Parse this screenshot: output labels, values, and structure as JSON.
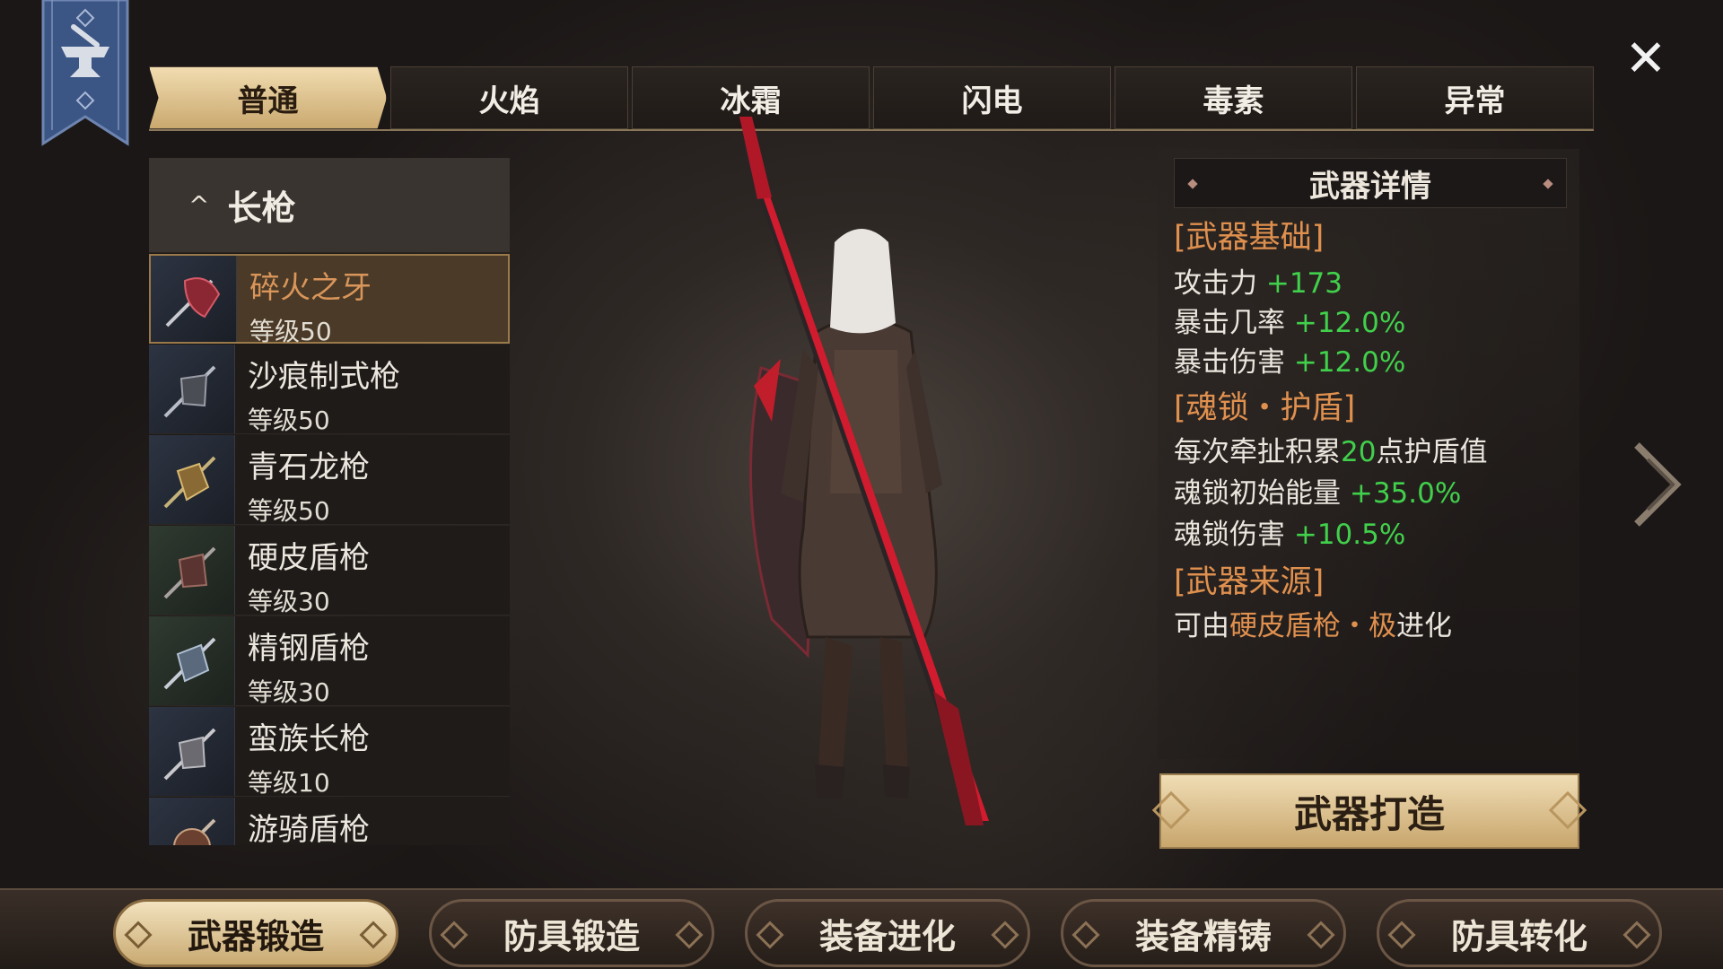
{
  "tabs": [
    {
      "label": "普通",
      "active": true
    },
    {
      "label": "火焰",
      "active": false
    },
    {
      "label": "冰霜",
      "active": false
    },
    {
      "label": "闪电",
      "active": false
    },
    {
      "label": "毒素",
      "active": false
    },
    {
      "label": "异常",
      "active": false
    }
  ],
  "weapon_list": {
    "category": "长枪",
    "items": [
      {
        "name": "碎火之牙",
        "level": "等级50",
        "selected": true
      },
      {
        "name": "沙痕制式枪",
        "level": "等级50",
        "selected": false
      },
      {
        "name": "青石龙枪",
        "level": "等级50",
        "selected": false
      },
      {
        "name": "硬皮盾枪",
        "level": "等级30",
        "selected": false
      },
      {
        "name": "精钢盾枪",
        "level": "等级30",
        "selected": false
      },
      {
        "name": "蛮族长枪",
        "level": "等级10",
        "selected": false
      },
      {
        "name": "游骑盾枪",
        "level": "",
        "selected": false
      }
    ]
  },
  "details": {
    "header": "武器详情",
    "base_title": "[武器基础]",
    "attack_label": "攻击力",
    "attack_value": "+173",
    "crit_rate_label": "暴击几率",
    "crit_rate_value": "+12.0%",
    "crit_dmg_label": "暴击伤害",
    "crit_dmg_value": "+12.0%",
    "soul_title": "[魂锁・护盾]",
    "shield_pre": "每次牵扯积累",
    "shield_num": "20",
    "shield_post": "点护盾值",
    "soul_energy_label": "魂锁初始能量",
    "soul_energy_value": "+35.0%",
    "soul_dmg_label": "魂锁伤害",
    "soul_dmg_value": "+10.5%",
    "source_title": "[武器来源]",
    "source_pre": "可由",
    "source_item": "硬皮盾枪・极",
    "source_post": "进化"
  },
  "forge_button": "武器打造",
  "bottom_nav": [
    {
      "label": "武器锻造",
      "active": true
    },
    {
      "label": "防具锻造",
      "active": false
    },
    {
      "label": "装备进化",
      "active": false
    },
    {
      "label": "装备精铸",
      "active": false
    },
    {
      "label": "防具转化",
      "active": false
    }
  ],
  "colors": {
    "accent_gold": "#d6b884",
    "stat_green": "#41d04b",
    "highlight_orange": "#e0904e"
  },
  "icons": [
    "anvil-banner-icon",
    "close-icon",
    "chevron-right-icon",
    "caret-up-icon"
  ]
}
